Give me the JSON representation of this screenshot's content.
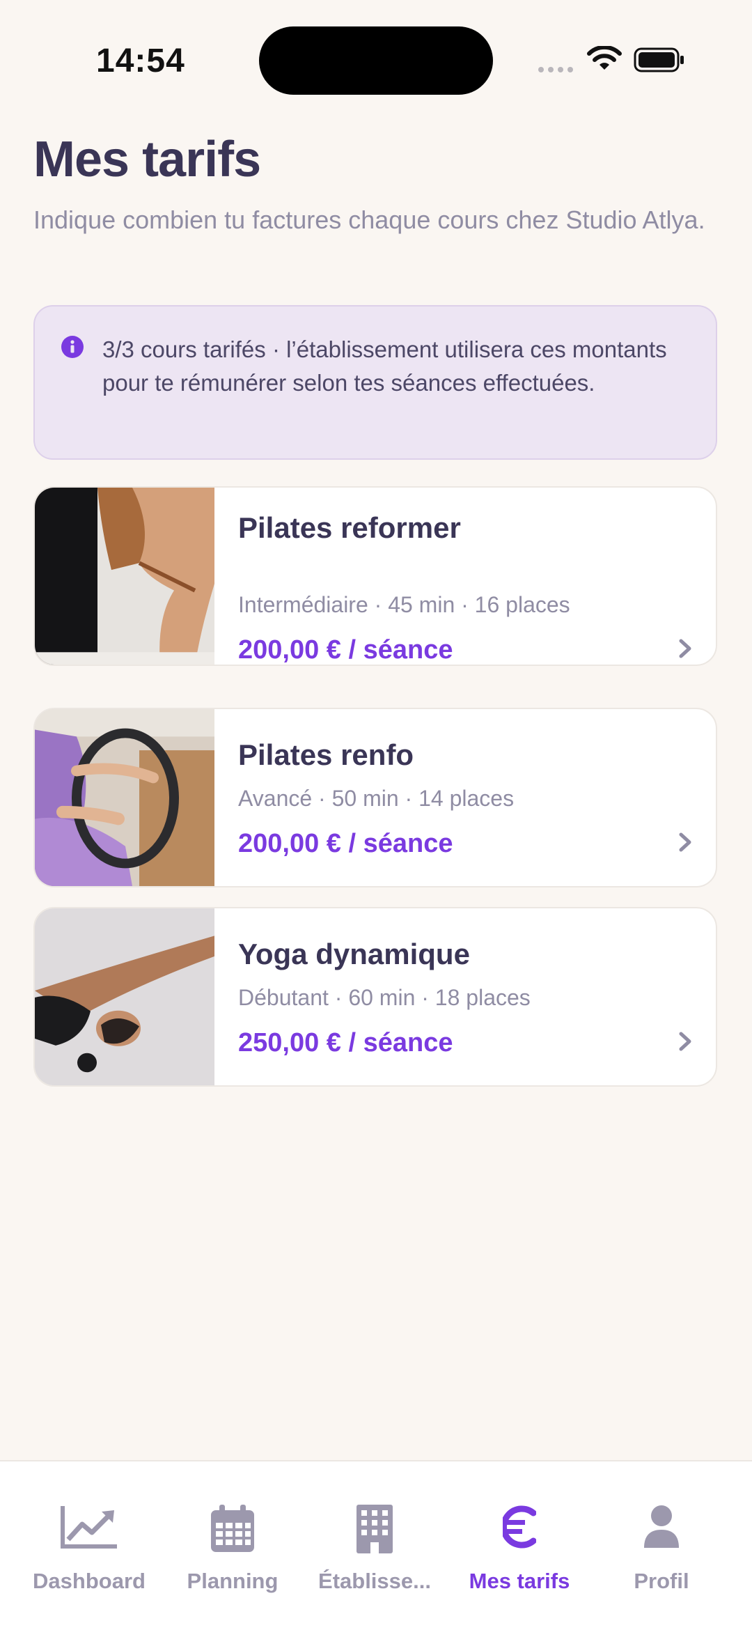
{
  "status_bar": {
    "time": "14:54"
  },
  "header": {
    "title": "Mes tarifs",
    "subtitle": "Indique combien tu factures chaque cours chez Studio Atlya."
  },
  "info": {
    "text": "3/3 cours tarifés · l’établissement utilisera ces montants pour te rémunérer selon tes séances effectuées."
  },
  "courses": [
    {
      "title": "Pilates reformer",
      "meta": "Intermédiaire · 45 min · 16 places",
      "price": "200,00 € / séance"
    },
    {
      "title": "Pilates renfo",
      "meta": "Avancé · 50 min · 14 places",
      "price": "200,00 € / séance"
    },
    {
      "title": "Yoga dynamique",
      "meta": "Débutant · 60 min · 18 places",
      "price": "250,00 € / séance"
    }
  ],
  "tabs": [
    {
      "label": "Dashboard",
      "icon": "chart-line-icon"
    },
    {
      "label": "Planning",
      "icon": "calendar-icon"
    },
    {
      "label": "Établisse...",
      "icon": "building-icon"
    },
    {
      "label": "Mes tarifs",
      "icon": "euro-icon",
      "active": true
    },
    {
      "label": "Profil",
      "icon": "user-icon"
    }
  ],
  "colors": {
    "accent": "#7a3ae0",
    "background": "#faf6f2",
    "text": "#3a3556",
    "muted": "#8f8ca3",
    "info_bg": "#ede5f3"
  }
}
